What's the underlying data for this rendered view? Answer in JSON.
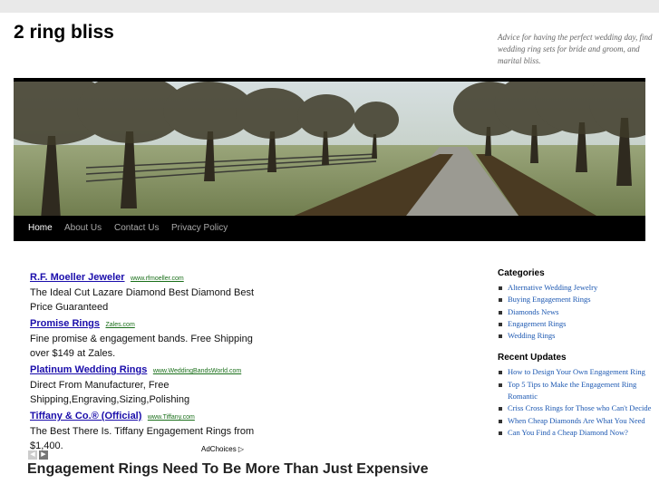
{
  "site": {
    "title": "2 ring bliss",
    "description": "Advice for having the perfect wedding day, find wedding ring sets for bride and groom, and marital bliss."
  },
  "nav": {
    "items": [
      "Home",
      "About Us",
      "Contact Us",
      "Privacy Policy"
    ]
  },
  "ads": [
    {
      "title": "R.F. Moeller Jeweler",
      "url": "www.rfmoeller.com",
      "text": "The Ideal Cut Lazare Diamond Best Diamond Best Price Guaranteed"
    },
    {
      "title": "Promise Rings",
      "url": "Zales.com",
      "text": "Fine promise & engagement bands. Free Shipping over $149 at Zales."
    },
    {
      "title": "Platinum Wedding Rings",
      "url": "www.WeddingBandsWorld.com",
      "text": "Direct From Manufacturer, Free Shipping,Engraving,Sizing,Polishing"
    },
    {
      "title": "Tiffany & Co.® (Official)",
      "url": "www.Tiffany.com",
      "text": "The Best There Is. Tiffany Engagement Rings from $1,400."
    }
  ],
  "adchoices": "AdChoices",
  "post": {
    "title": "Engagement Rings Need To Be More Than Just Expensive"
  },
  "sidebar": {
    "categories_heading": "Categories",
    "categories": [
      "Alternative Wedding Jewelry",
      "Buying Engagement Rings",
      "Diamonds News",
      "Engagement Rings",
      "Wedding Rings"
    ],
    "recent_heading": "Recent Updates",
    "recent": [
      "How to Design Your Own Engagement Ring",
      "Top 5 Tips to Make the Engagement Ring Romantic",
      "Criss Cross Rings for Those who Can't Decide",
      "When Cheap Diamonds Are What You Need",
      "Can You Find a Cheap Diamond Now?"
    ]
  }
}
